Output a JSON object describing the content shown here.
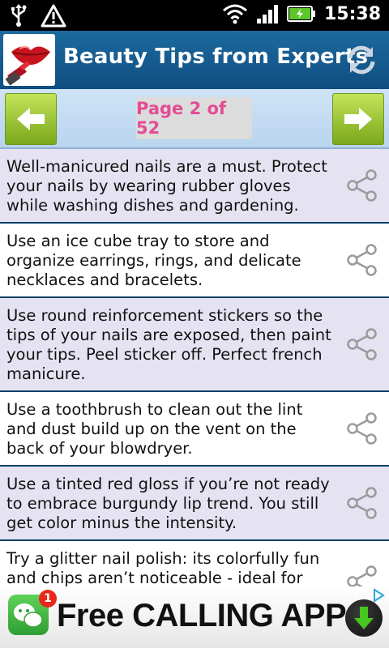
{
  "status_bar": {
    "time": "15:38",
    "icons": [
      "usb-icon",
      "warning-icon",
      "wifi-icon",
      "signal-icon",
      "battery-icon"
    ]
  },
  "header": {
    "title": "Beauty Tips from Experts",
    "logo_icon": "lips-logo",
    "refresh_icon": "refresh-icon"
  },
  "pager": {
    "indicator": "Page 2 of 52",
    "prev_icon": "arrow-left-icon",
    "next_icon": "arrow-right-icon"
  },
  "tips": [
    {
      "text": "Well-manicured nails are a must. Protect your nails by wearing rubber gloves while washing dishes and gardening."
    },
    {
      "text": "Use an ice cube tray to store and organize earrings, rings, and delicate necklaces and bracelets."
    },
    {
      "text": "Use round reinforcement stickers so the tips of your nails are exposed, then paint your tips. Peel sticker off. Perfect french manicure."
    },
    {
      "text": "Use a toothbrush to clean out the lint and dust build up on the vent on the back of your blowdryer."
    },
    {
      "text": "Use a tinted red gloss if you’re not ready to embrace burgundy lip trend. You still get color minus the intensity."
    },
    {
      "text": "Try a glitter nail polish: its colorfully fun and chips aren’t noticeable - ideal for summer’s"
    }
  ],
  "ad": {
    "badge": "1",
    "text": "Free CALLING APP",
    "icons": [
      "chat-app-icon",
      "download-icon",
      "ad-choices-icon"
    ]
  },
  "colors": {
    "header_bg": "#1b5f93",
    "pager_bg": "#c6dcf2",
    "arrow_green": "#9cc73a",
    "page_text_pink": "#e34c95",
    "alt_row_bg": "#e5e3f1",
    "divider": "#0e3f68"
  }
}
